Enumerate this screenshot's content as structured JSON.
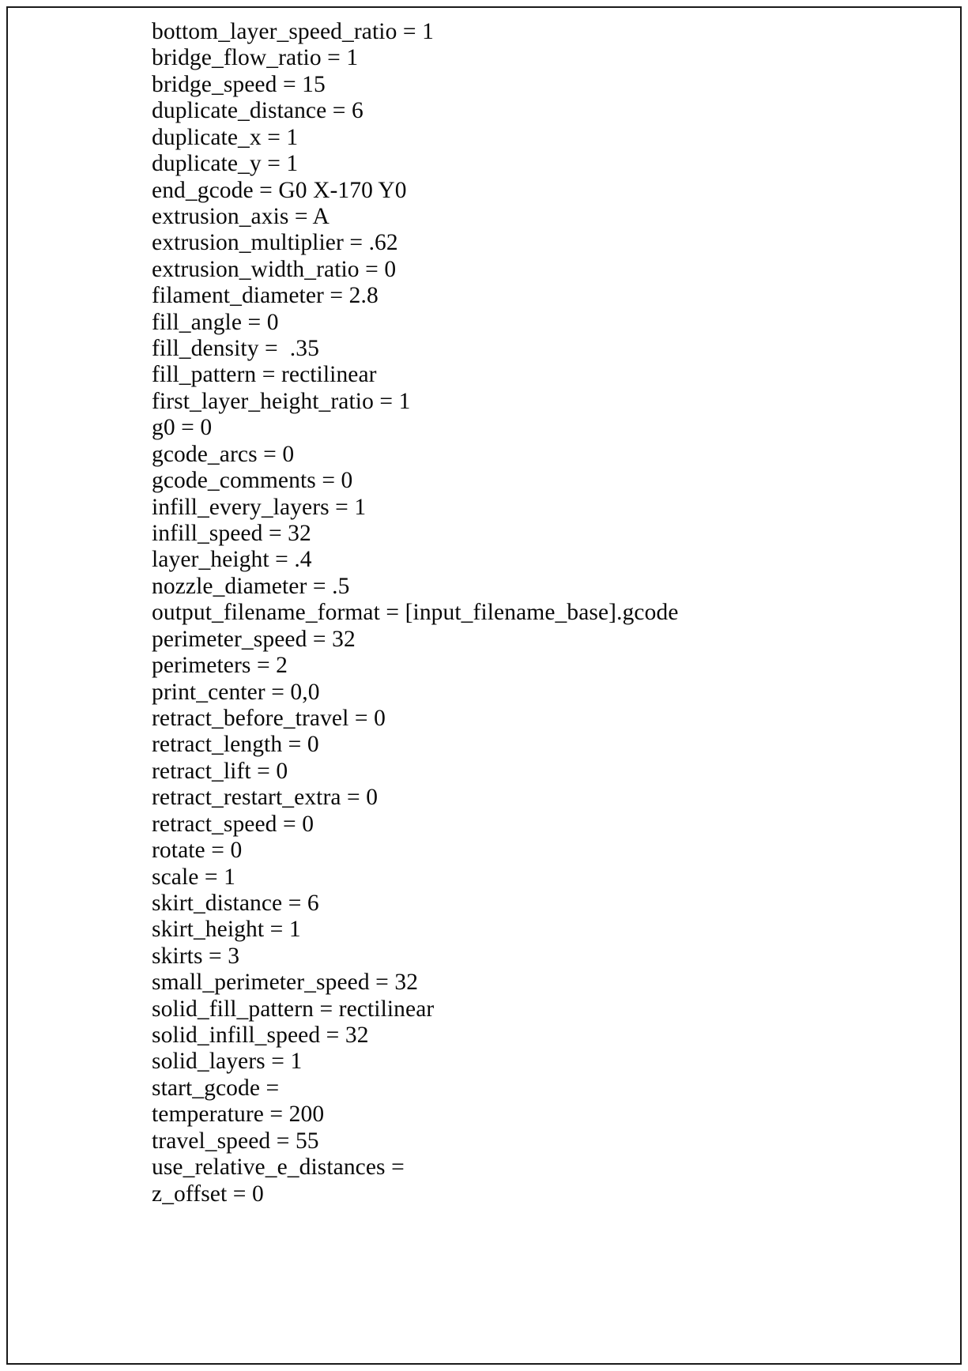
{
  "document": {
    "type": "configuration-listing",
    "background_color": "#ffffff",
    "text_color": "#000000",
    "border_color": "#1a1a1a"
  },
  "config_lines": [
    "bottom_layer_speed_ratio = 1",
    "bridge_flow_ratio = 1",
    "bridge_speed = 15",
    "duplicate_distance = 6",
    "duplicate_x = 1",
    "duplicate_y = 1",
    "end_gcode = G0 X-170 Y0",
    "extrusion_axis = A",
    "extrusion_multiplier = .62",
    "extrusion_width_ratio = 0",
    "filament_diameter = 2.8",
    "fill_angle = 0",
    "fill_density =  .35",
    "fill_pattern = rectilinear",
    "first_layer_height_ratio = 1",
    "g0 = 0",
    "gcode_arcs = 0",
    "gcode_comments = 0",
    "infill_every_layers = 1",
    "infill_speed = 32",
    "layer_height = .4",
    "nozzle_diameter = .5",
    "output_filename_format = [input_filename_base].gcode",
    "perimeter_speed = 32",
    "perimeters = 2",
    "print_center = 0,0",
    "retract_before_travel = 0",
    "retract_length = 0",
    "retract_lift = 0",
    "retract_restart_extra = 0",
    "retract_speed = 0",
    "rotate = 0",
    "scale = 1",
    "skirt_distance = 6",
    "skirt_height = 1",
    "skirts = 3",
    "small_perimeter_speed = 32",
    "solid_fill_pattern = rectilinear",
    "solid_infill_speed = 32",
    "solid_layers = 1",
    "start_gcode =",
    "temperature = 200",
    "travel_speed = 55",
    "use_relative_e_distances =",
    "z_offset = 0"
  ]
}
